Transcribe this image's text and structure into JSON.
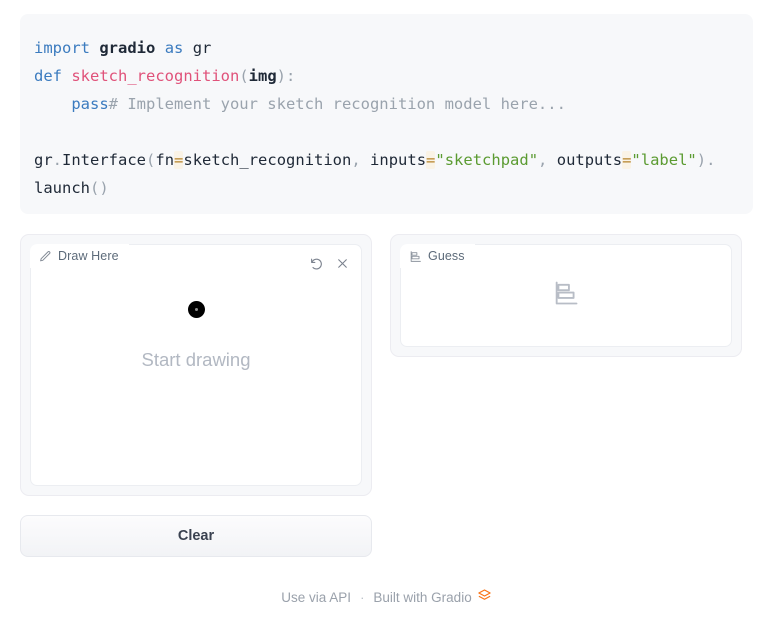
{
  "code": {
    "lines": [
      {
        "id": "l1",
        "tokens": [
          {
            "t": "import",
            "c": "kw"
          },
          {
            "t": " ",
            "c": "sp"
          },
          {
            "t": "gradio",
            "c": "plain"
          },
          {
            "t": " ",
            "c": "sp"
          },
          {
            "t": "as",
            "c": "kw"
          },
          {
            "t": " ",
            "c": "sp"
          },
          {
            "t": "gr",
            "c": "name"
          }
        ]
      },
      {
        "id": "l2",
        "tokens": [
          {
            "t": "def",
            "c": "kw"
          },
          {
            "t": " ",
            "c": "sp"
          },
          {
            "t": "sketch_recognition",
            "c": "fn"
          },
          {
            "t": "(",
            "c": "punct"
          },
          {
            "t": "img",
            "c": "plain"
          },
          {
            "t": ")",
            "c": "punct"
          },
          {
            "t": ":",
            "c": "punct"
          }
        ]
      },
      {
        "id": "l3",
        "tokens": [
          {
            "t": "    ",
            "c": "sp"
          },
          {
            "t": "pass",
            "c": "kw"
          },
          {
            "t": "# Implement your sketch recognition model here...",
            "c": "comment"
          }
        ]
      },
      {
        "id": "l4",
        "tokens": [
          {
            "t": " ",
            "c": "sp"
          }
        ]
      },
      {
        "id": "l5",
        "tokens": [
          {
            "t": "gr",
            "c": "name"
          },
          {
            "t": ".",
            "c": "dot"
          },
          {
            "t": "Interface",
            "c": "name"
          },
          {
            "t": "(",
            "c": "punct"
          },
          {
            "t": "fn",
            "c": "name"
          },
          {
            "t": "=",
            "c": "op"
          },
          {
            "t": "sketch_recognition",
            "c": "name"
          },
          {
            "t": ",",
            "c": "punct"
          },
          {
            "t": " ",
            "c": "sp"
          },
          {
            "t": "inputs",
            "c": "name"
          },
          {
            "t": "=",
            "c": "op"
          },
          {
            "t": "\"sketchpad\"",
            "c": "str"
          },
          {
            "t": ",",
            "c": "punct"
          },
          {
            "t": " ",
            "c": "sp"
          },
          {
            "t": "outputs",
            "c": "name"
          },
          {
            "t": "=",
            "c": "op"
          },
          {
            "t": "\"label\"",
            "c": "str"
          },
          {
            "t": ")",
            "c": "punct"
          },
          {
            "t": ".",
            "c": "dot"
          }
        ]
      },
      {
        "id": "l6",
        "tokens": [
          {
            "t": "launch",
            "c": "name"
          },
          {
            "t": "(",
            "c": "punct"
          },
          {
            "t": ")",
            "c": "punct"
          }
        ]
      }
    ]
  },
  "sketchpad": {
    "label": "Draw Here",
    "label_icon": "pencil-icon",
    "undo_icon": "undo-icon",
    "remove_icon": "close-icon",
    "placeholder_text": "Start drawing",
    "brush_cursor": "black-dot",
    "clear_button": "Clear"
  },
  "guess": {
    "label": "Guess",
    "label_icon": "bar-chart-icon",
    "placeholder_icon": "bar-chart-icon"
  },
  "footer": {
    "api_link": "Use via API",
    "separator": "·",
    "built_with": "Built with Gradio",
    "logo_icon": "gradio-logo-icon"
  },
  "colors": {
    "page_background": "#ffffff",
    "code_background": "#f7f8fa",
    "panel_background": "#f7f8fa",
    "panel_border": "#ececf1",
    "canvas_background": "#ffffff",
    "keyword": "#3b7bbf",
    "function_name": "#e0527a",
    "string": "#5b9b31",
    "comment": "#9aa3ad",
    "operator": "#b5842c",
    "placeholder_text": "#b2b8c2",
    "footer_text": "#9aa1ab",
    "gradio_orange": "#f97316",
    "clear_button_text": "#3a4250"
  }
}
